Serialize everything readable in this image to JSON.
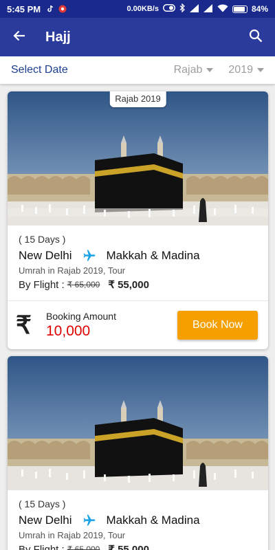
{
  "status_bar": {
    "time": "5:45 PM",
    "network_speed": "0.00KB/s",
    "volte": "Vo) LTE",
    "battery": "84%"
  },
  "app_bar": {
    "title": "Hajj",
    "back_icon": "arrow-left-icon",
    "search_icon": "search-icon"
  },
  "filter": {
    "select_date_label": "Select Date",
    "month": "Rajab",
    "year": "2019"
  },
  "colors": {
    "status_bar": "#1a2a8c",
    "app_bar": "#2a3b9b",
    "accent_orange": "#f59f00",
    "amount_red": "#e00000",
    "plane_blue": "#1aa3e6"
  },
  "packages": [
    {
      "period_tag": "Rajab 2019",
      "duration": "( 15 Days )",
      "from": "New Delhi",
      "to": "Makkah & Madina",
      "subtitle": "Umrah in Rajab 2019,  Tour",
      "travel_mode": "By Flight : ",
      "old_price": "₹ 65,000",
      "new_price": "₹ 55,000",
      "currency_symbol": "₹",
      "booking_label": "Booking Amount",
      "booking_amount": "10,000",
      "button_label": "Book Now"
    },
    {
      "duration": "( 15 Days )",
      "from": "New Delhi",
      "to": "Makkah & Madina",
      "subtitle": "Umrah in Rajab 2019,  Tour",
      "travel_mode": "By Flight : ",
      "old_price": "₹ 65,000",
      "new_price": "₹ 55,000"
    }
  ]
}
